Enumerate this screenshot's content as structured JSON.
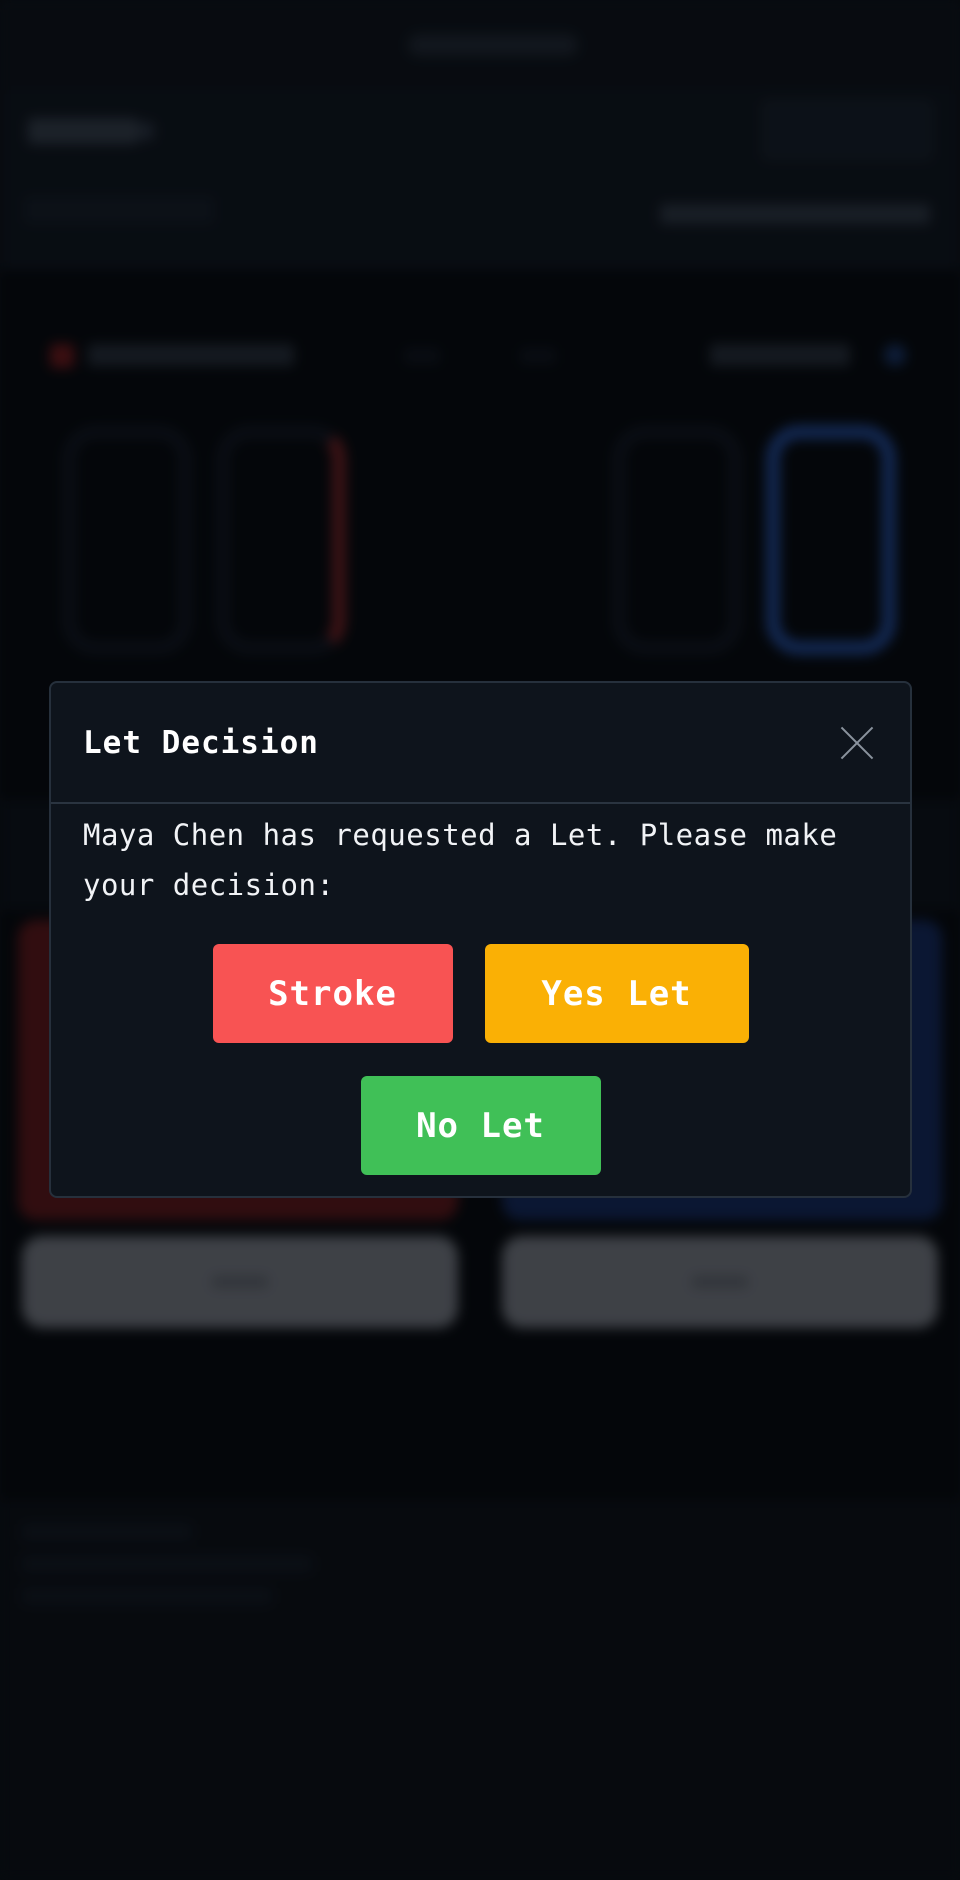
{
  "dialog": {
    "title": "Let Decision",
    "message": "Maya Chen has requested a Let. Please make your decision:",
    "buttons": {
      "stroke": "Stroke",
      "yes_let": "Yes Let",
      "no_let": "No Let"
    }
  },
  "colors": {
    "stroke": "#f85353",
    "yes_let": "#fab005",
    "no_let": "#40c057",
    "modal_bg": "#0e141c",
    "page_bg": "#0a0d12"
  },
  "icons": {
    "close": "close-icon"
  }
}
